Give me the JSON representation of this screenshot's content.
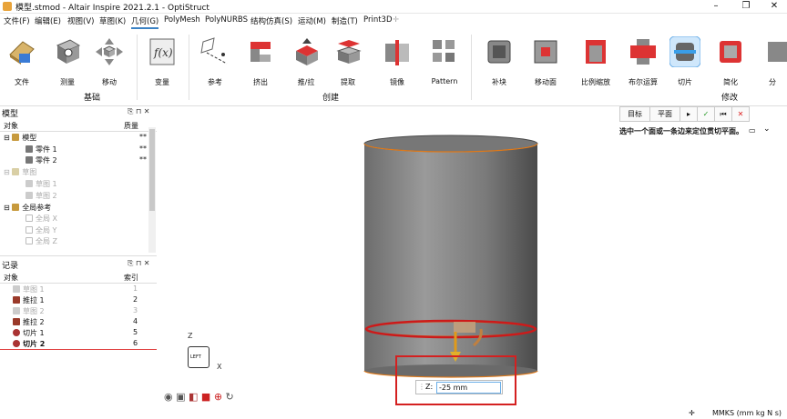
{
  "app": {
    "title": "模型.stmod - Altair Inspire 2021.2.1 - OptiStruct"
  },
  "menubar": {
    "items": [
      "文件(F)",
      "编辑(E)",
      "视图(V)",
      "草图(K)",
      "几何(G)",
      "PolyMesh",
      "PolyNURBS",
      "结构仿真(S)",
      "运动(M)",
      "制造(T)",
      "Print3D"
    ]
  },
  "ribbon": {
    "groups": {
      "basic": "基础",
      "create": "创建",
      "modify": "修改"
    },
    "tools": {
      "file": "文件",
      "measure": "测量",
      "move": "移动",
      "variable": "变量",
      "reference": "参考",
      "extrude": "挤出",
      "pushpull": "推/拉",
      "extract": "提取",
      "mirror": "镜像",
      "pattern": "Pattern",
      "patch": "补块",
      "moveface": "移动面",
      "scale": "比例缩放",
      "boolean": "布尔运算",
      "slice": "切片",
      "simplify": "简化",
      "partial": "分"
    }
  },
  "model_panel": {
    "title": "模型",
    "col_object": "对象",
    "col_mass": "质量",
    "rows": [
      {
        "label": "模型",
        "mass": "**"
      },
      {
        "label": "零件 1",
        "mass": "**"
      },
      {
        "label": "零件 2",
        "mass": "**"
      },
      {
        "label": "草图",
        "mass": ""
      },
      {
        "label": "草图 1",
        "mass": ""
      },
      {
        "label": "草图 2",
        "mass": ""
      },
      {
        "label": "全局参考",
        "mass": ""
      },
      {
        "label": "全局 X",
        "mass": ""
      },
      {
        "label": "全局 Y",
        "mass": ""
      },
      {
        "label": "全局 Z",
        "mass": ""
      }
    ]
  },
  "history_panel": {
    "title": "记录",
    "col_object": "对象",
    "col_index": "索引",
    "rows": [
      {
        "label": "草图 1",
        "index": "1"
      },
      {
        "label": "推拉 1",
        "index": "2"
      },
      {
        "label": "草图 2",
        "index": "3"
      },
      {
        "label": "推拉 2",
        "index": "4"
      },
      {
        "label": "切片 1",
        "index": "5"
      },
      {
        "label": "切片 2",
        "index": "6"
      }
    ]
  },
  "slice_toolbar": {
    "target": "目标",
    "plane": "平面",
    "hint": "选中一个面或一条边来定位贯切平面。"
  },
  "z_input": {
    "label": "Z:",
    "value": "-25 mm"
  },
  "triad": {
    "z": "Z",
    "x": "X",
    "cube_face": "LEFT"
  },
  "status": {
    "units": "MMKS (mm kg N s)"
  },
  "colors": {
    "accent": "#3b82c4",
    "highlight_red": "#cc1a1a",
    "edge_orange": "#e07a1a"
  }
}
